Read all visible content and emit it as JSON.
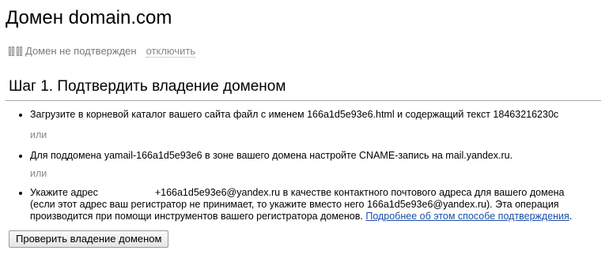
{
  "page": {
    "title": "Домен domain.com"
  },
  "status": {
    "icon": "status-bars-icon",
    "text": "Домен не подтвержден",
    "disconnect_label": "отключить"
  },
  "step": {
    "header": "Шаг 1.  Подтвердить владение доменом",
    "items": [
      "Загрузите в корневой каталог вашего сайта файл с именем 166a1d5e93e6.html и содержащий текст 18463216230c",
      "Для поддомена yamail-166a1d5e93e6 в зоне вашего домена настройте CNAME-запись на mail.yandex.ru."
    ],
    "or_label": "или",
    "item3": {
      "prefix": "Укажите адрес",
      "line1_rest": "+166a1d5e93e6@yandex.ru в качестве контактного почтового адреса для вашего домена",
      "line2": "(если этот адрес ваш регистратор не принимает, то укажите вместо него 166a1d5e93e6@yandex.ru). Эта операция",
      "line3": "производится при помощи инструментов вашего регистратора доменов.",
      "link": "Подробнее об этом способе подтверждения",
      "link_suffix": "."
    }
  },
  "verify_button_label": "Проверить владение доменом"
}
